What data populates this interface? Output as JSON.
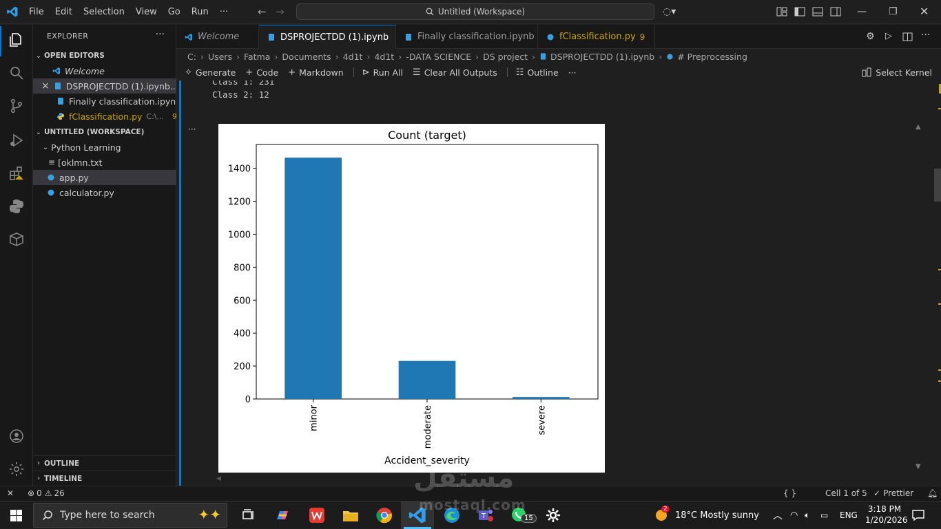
{
  "menu": [
    "File",
    "Edit",
    "Selection",
    "View",
    "Go",
    "Run",
    "···"
  ],
  "command_center": "Untitled (Workspace)",
  "explorer": {
    "title": "EXPLORER",
    "open_editors_label": "OPEN EDITORS",
    "open_editors": [
      {
        "name": "Welcome",
        "italic": true
      },
      {
        "name": "DSPROJECTDD (1).ipynb...",
        "close": "×"
      },
      {
        "name": "Finally classification.ipynb..."
      },
      {
        "name": "fClassification.py",
        "path": "C:\\...",
        "badge": "9"
      }
    ],
    "workspace_label": "UNTITLED (WORKSPACE)",
    "folder": "Python Learning",
    "files": [
      "[oklmn.txt",
      "app.py",
      "calculator.py"
    ],
    "outline_label": "OUTLINE",
    "timeline_label": "TIMELINE"
  },
  "tabs": [
    {
      "label": "Welcome"
    },
    {
      "label": "DSPROJECTDD (1).ipynb",
      "close": "×"
    },
    {
      "label": "Finally classification.ipynb"
    },
    {
      "label": "fClassification.py",
      "badge": "9"
    }
  ],
  "breadcrumb": [
    "C:",
    "Users",
    "Fatma",
    "Documents",
    "4d1t",
    "4d1t",
    "-DATA SCIENCE",
    "DS project",
    "DSPROJECTDD (1).ipynb",
    "# Preprocessing"
  ],
  "notebook_toolbar": {
    "generate": "Generate",
    "code": "Code",
    "markdown": "Markdown",
    "run_all": "Run All",
    "clear_outputs": "Clear All Outputs",
    "outline": "Outline",
    "more": "···",
    "kernel": "Select Kernel"
  },
  "output_lines": [
    "Class 1: 231",
    "Class 2: 12"
  ],
  "output_more": "···",
  "chart_data": {
    "type": "bar",
    "title": "Count (target)",
    "xlabel": "Accident_severity",
    "ylabel": "",
    "categories": [
      "minor",
      "moderate",
      "severe"
    ],
    "values": [
      1465,
      231,
      12
    ],
    "ylim": [
      0,
      1545
    ],
    "yticks": [
      0,
      200,
      400,
      600,
      800,
      1000,
      1200,
      1400
    ],
    "bar_color": "#1f77b4",
    "grid": false
  },
  "statusbar": {
    "errors": "0",
    "warnings": "26",
    "braces": "{ }",
    "cell": "Cell 1 of 5",
    "prettier": "Prettier"
  },
  "taskbar": {
    "search_placeholder": "Type here to search",
    "whatsapp_badge": "15",
    "weather": "18°C  Mostly sunny",
    "weather_badge": "2",
    "lang": "ENG",
    "time": "3:18 PM",
    "date": "1/20/2026"
  },
  "watermark": "مستقل",
  "watermark_url": "mostaql.com"
}
